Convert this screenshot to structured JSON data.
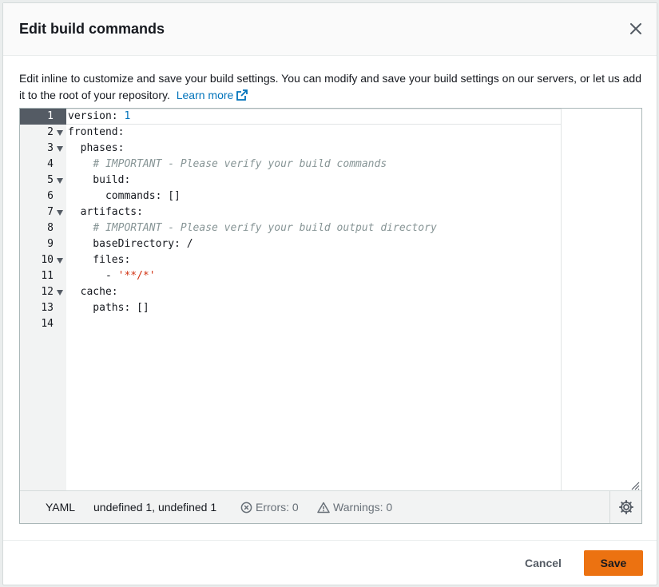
{
  "dialog": {
    "title": "Edit build commands",
    "description": "Edit inline to customize and save your build settings. You can modify and save your build settings on our servers, or let us add it to the root of your repository.",
    "learn_more": "Learn more"
  },
  "editor": {
    "lines": [
      {
        "n": "1",
        "fold": false
      },
      {
        "n": "2",
        "fold": true
      },
      {
        "n": "3",
        "fold": true
      },
      {
        "n": "4",
        "fold": false
      },
      {
        "n": "5",
        "fold": true
      },
      {
        "n": "6",
        "fold": false
      },
      {
        "n": "7",
        "fold": true
      },
      {
        "n": "8",
        "fold": false
      },
      {
        "n": "9",
        "fold": false
      },
      {
        "n": "10",
        "fold": true
      },
      {
        "n": "11",
        "fold": false
      },
      {
        "n": "12",
        "fold": true
      },
      {
        "n": "13",
        "fold": false
      },
      {
        "n": "14",
        "fold": false
      }
    ],
    "code": {
      "l1_key": "version: ",
      "l1_val": "1",
      "l2": "frontend:",
      "l3": "  phases:",
      "l4_indent": "    ",
      "l4_comment": "# IMPORTANT - Please verify your build commands",
      "l5": "    build:",
      "l6": "      commands: []",
      "l7": "  artifacts:",
      "l8_indent": "    ",
      "l8_comment": "# IMPORTANT - Please verify your build output directory",
      "l9": "    baseDirectory: /",
      "l10": "    files:",
      "l11_prefix": "      - ",
      "l11_str": "'**/*'",
      "l12": "  cache:",
      "l13": "    paths: []",
      "l14": ""
    },
    "status": {
      "mode": "YAML",
      "cursor": "undefined 1, undefined 1",
      "errors": "Errors: 0",
      "warnings": "Warnings: 0"
    }
  },
  "footer": {
    "cancel_label": "Cancel",
    "save_label": "Save"
  },
  "colors": {
    "accent": "#ec7211",
    "link": "#0073bb",
    "comment": "#879596",
    "string": "#d13212"
  },
  "icons": [
    "close-icon",
    "external-link-icon",
    "error-circle-icon",
    "warning-triangle-icon",
    "settings-gear-icon",
    "resize-handle-icon",
    "fold-arrow-icon"
  ]
}
